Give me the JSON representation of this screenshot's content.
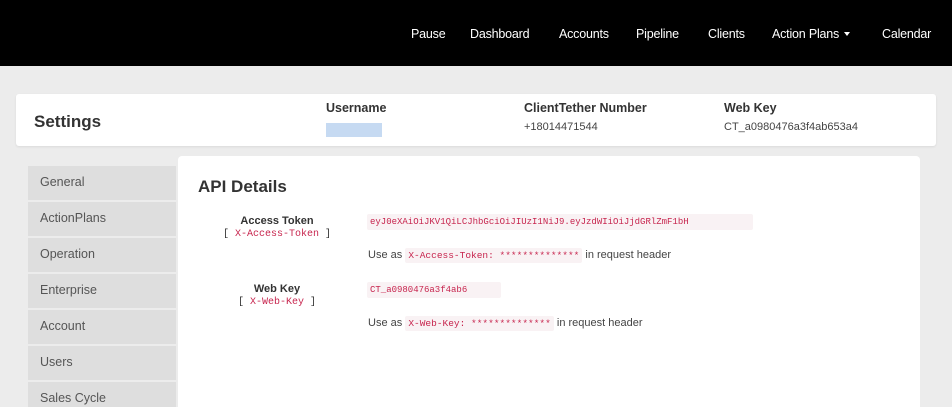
{
  "nav": {
    "items": [
      {
        "label": "Pause"
      },
      {
        "label": "Dashboard"
      },
      {
        "label": "Accounts"
      },
      {
        "label": "Pipeline"
      },
      {
        "label": "Clients"
      },
      {
        "label": "Action Plans"
      },
      {
        "label": "Calendar"
      }
    ]
  },
  "header": {
    "title": "Settings",
    "username_label": "Username",
    "number_label": "ClientTether Number",
    "number_value": "+18014471544",
    "webkey_label": "Web Key",
    "webkey_value": "CT_a0980476a3f4ab653a4"
  },
  "sidebar": {
    "items": [
      {
        "label": "General"
      },
      {
        "label": "ActionPlans"
      },
      {
        "label": "Operation"
      },
      {
        "label": "Enterprise"
      },
      {
        "label": "Account"
      },
      {
        "label": "Users"
      },
      {
        "label": "Sales Cycle"
      }
    ]
  },
  "api": {
    "title": "API Details",
    "access_token": {
      "label": "Access Token",
      "header_name": "X-Access-Token",
      "value": "eyJ0eXAiOiJKV1QiLCJhbGciOiJIUzI1NiJ9.eyJzdWIiOiJjdGRlZmF1bH",
      "use_prefix": "Use as",
      "use_code": "X-Access-Token: **************",
      "use_suffix": "in request header"
    },
    "web_key": {
      "label": "Web Key",
      "header_name": "X-Web-Key",
      "value": "CT_a0980476a3f4ab6",
      "use_prefix": "Use as",
      "use_code": "X-Web-Key: **************",
      "use_suffix": "in request header"
    }
  }
}
